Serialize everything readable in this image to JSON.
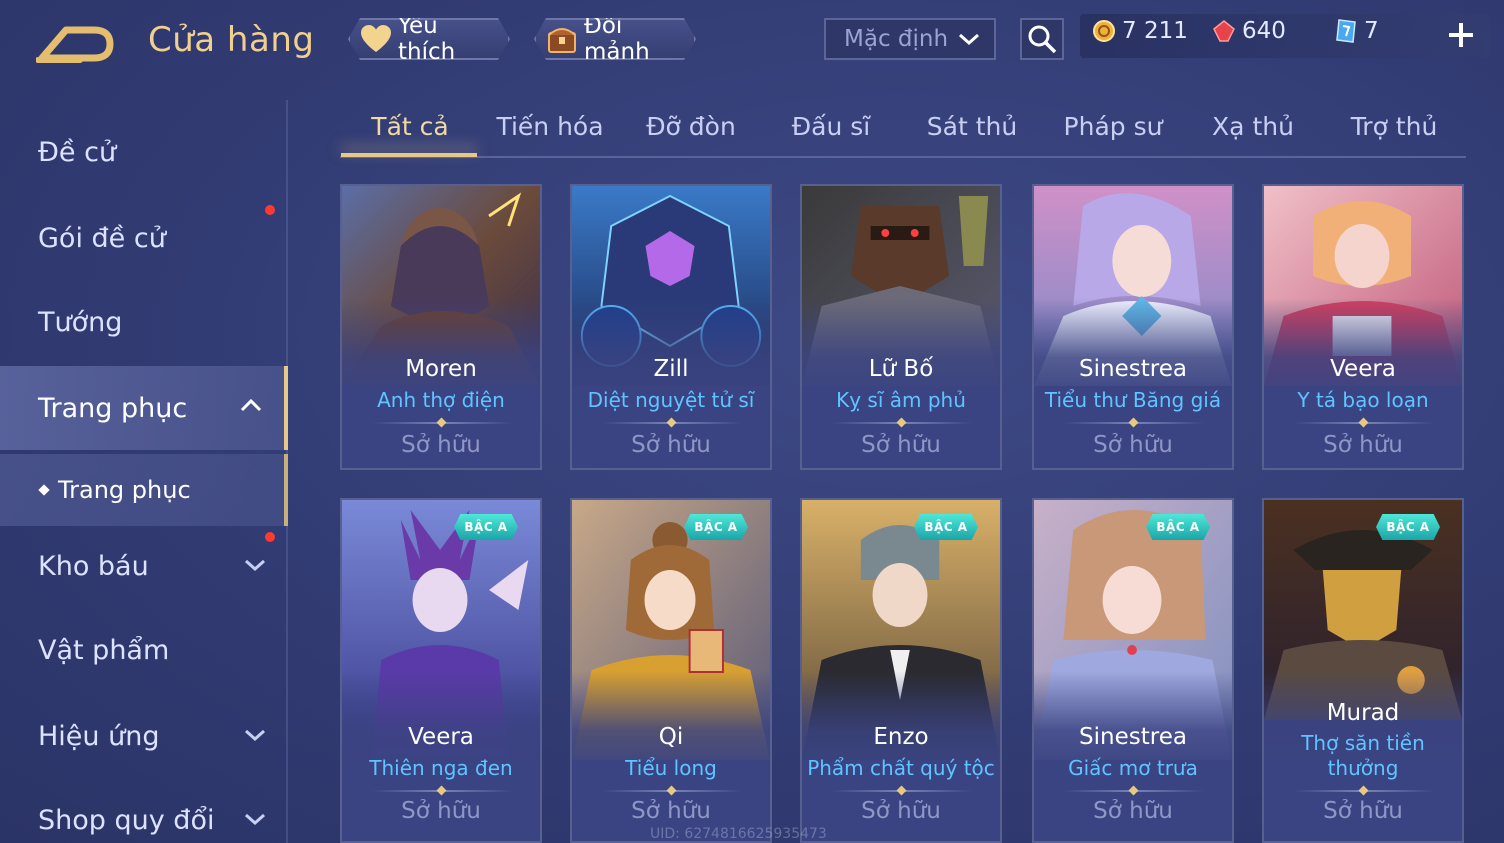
{
  "header": {
    "title": "Cửa hàng",
    "favorite_label": "Yêu thích",
    "shard_label": "Đổi mảnh",
    "sort_value": "Mặc định",
    "currency": {
      "gold": "7 211",
      "ruby": "640",
      "voucher": "7"
    }
  },
  "sidebar": {
    "items": [
      {
        "label": "Đề cử"
      },
      {
        "label": "Gói đề cử"
      },
      {
        "label": "Tướng"
      },
      {
        "label": "Trang phục"
      },
      {
        "label": "Kho báu"
      },
      {
        "label": "Vật phẩm"
      },
      {
        "label": "Hiệu ứng"
      },
      {
        "label": "Shop quy đổi"
      }
    ],
    "sub_item": "Trang phục"
  },
  "tabs": [
    "Tất cả",
    "Tiến hóa",
    "Đỡ đòn",
    "Đấu sĩ",
    "Sát thủ",
    "Pháp sư",
    "Xạ thủ",
    "Trợ thủ"
  ],
  "cards": [
    {
      "hero": "Moren",
      "skin": "Anh thợ điện",
      "status": "Sở hữu"
    },
    {
      "hero": "Zill",
      "skin": "Diệt nguyệt tử sĩ",
      "status": "Sở hữu"
    },
    {
      "hero": "Lữ Bố",
      "skin": "Kỵ sĩ âm phủ",
      "status": "Sở hữu"
    },
    {
      "hero": "Sinestrea",
      "skin": "Tiểu thư Băng giá",
      "status": "Sở hữu"
    },
    {
      "hero": "Veera",
      "skin": "Y tá bạo loạn",
      "status": "Sở hữu"
    },
    {
      "hero": "Veera",
      "skin": "Thiên nga đen",
      "status": "Sở hữu",
      "badge": "BẬC A"
    },
    {
      "hero": "Qi",
      "skin": "Tiểu long",
      "status": "Sở hữu",
      "badge": "BẬC A"
    },
    {
      "hero": "Enzo",
      "skin": "Phẩm chất quý tộc",
      "status": "Sở hữu",
      "badge": "BẬC A"
    },
    {
      "hero": "Sinestrea",
      "skin": "Giấc mơ trưa",
      "status": "Sở hữu",
      "badge": "BẬC A"
    },
    {
      "hero": "Murad",
      "skin_line1": "Thợ săn tiền",
      "skin_line2": "thưởng",
      "status": "Sở hữu",
      "badge": "BẬC A"
    }
  ],
  "uid_text": "UID: 6274816625935473",
  "colors": {
    "accent_gold": "#f1cf8c",
    "skin_name_blue": "#5fc4ff",
    "badge_teal": "#2cc9c3",
    "notification_red": "#ff3b30"
  }
}
